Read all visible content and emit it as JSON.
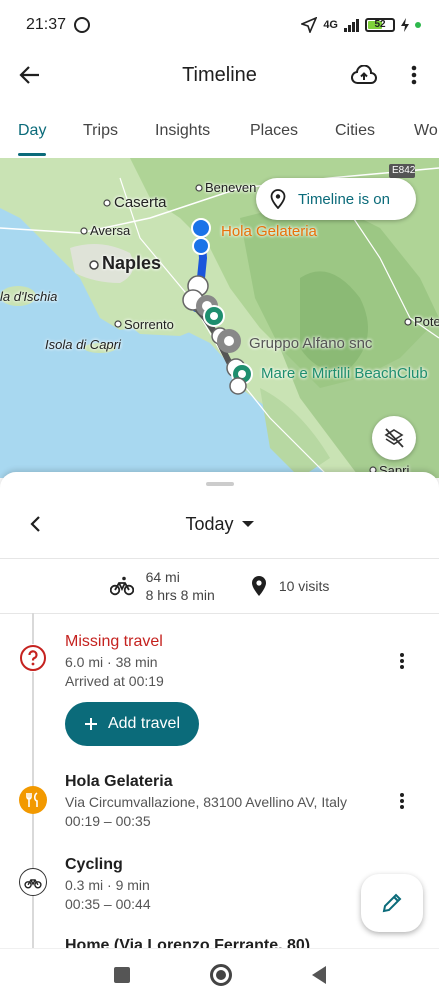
{
  "status": {
    "time": "21:37",
    "network": "4G",
    "battery": "52"
  },
  "app": {
    "title": "Timeline"
  },
  "tabs": [
    {
      "label": "Day",
      "active": true
    },
    {
      "label": "Trips"
    },
    {
      "label": "Insights"
    },
    {
      "label": "Places"
    },
    {
      "label": "Cities"
    },
    {
      "label": "Wo"
    }
  ],
  "map": {
    "chip_label": "Timeline is on",
    "labels": {
      "benevento": "Beneven",
      "caserta": "Caserta",
      "aversa": "Aversa",
      "naples": "Naples",
      "ischia": "la d'Ischia",
      "sorrento": "Sorrento",
      "capri": "Isola di Capri",
      "potenza": "Pote",
      "sapri": "Sapri",
      "road": "E842",
      "hola": "Hola Gelateria",
      "gruppo": "Gruppo Alfano snc",
      "mare": "Mare e Mirtilli BeachClub"
    }
  },
  "sheet": {
    "day_label": "Today",
    "summary": {
      "distance": "64 mi",
      "duration": "8 hrs 8 min",
      "visits": "10 visits"
    },
    "entries": [
      {
        "title": "Missing travel",
        "line1": "6.0 mi · 38 min",
        "line2": "Arrived at 00:19"
      },
      {
        "title": "Hola Gelateria",
        "line1": "Via Circumvallazione, 83100 Avellino AV, Italy",
        "line2": "00:19 – 00:35"
      },
      {
        "title": "Cycling",
        "line1": "0.3 mi · 9 min",
        "line2": "00:35 – 00:44"
      },
      {
        "title": "Home (Via Lorenzo Ferrante, 80)"
      }
    ],
    "add_travel_label": "Add travel"
  },
  "colors": {
    "accent": "#0b6b7a",
    "warning": "#c5221f",
    "food": "#f29900"
  }
}
